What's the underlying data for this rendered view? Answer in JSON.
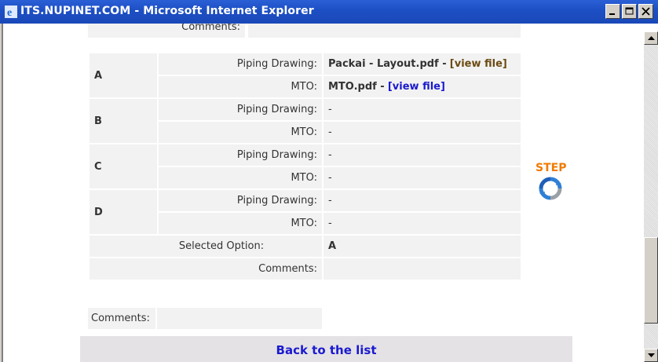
{
  "window": {
    "title": "ITS.NUPINET.COM - Microsoft Internet Explorer"
  },
  "top_partial": {
    "label": "Comments:"
  },
  "options": [
    {
      "name": "A",
      "piping_label": "Piping Drawing:",
      "piping_value": "Packai - Layout.pdf -",
      "piping_link": "[view file]",
      "mto_label": "MTO:",
      "mto_value": "MTO.pdf -",
      "mto_link": "[view file]"
    },
    {
      "name": "B",
      "piping_label": "Piping Drawing:",
      "piping_value": "-",
      "mto_label": "MTO:",
      "mto_value": "-"
    },
    {
      "name": "C",
      "piping_label": "Piping Drawing:",
      "piping_value": "-",
      "mto_label": "MTO:",
      "mto_value": "-"
    },
    {
      "name": "D",
      "piping_label": "Piping Drawing:",
      "piping_value": "-",
      "mto_label": "MTO:",
      "mto_value": "-"
    }
  ],
  "selected_option": {
    "label": "Selected Option:",
    "value": "A"
  },
  "comments_inner": {
    "label": "Comments:",
    "value": ""
  },
  "comments_outer": {
    "label": "Comments:",
    "value": ""
  },
  "logo": {
    "text": "STEP",
    "color": "#f07a00",
    "icon": "circular-arrows-icon"
  },
  "footer": {
    "back_link": "Back to the list"
  },
  "colors": {
    "titlebar": "#1d4fc4",
    "link_blue": "#1a1ad0",
    "link_brown": "#6b4b12",
    "cell_bg": "#f2f2f2"
  }
}
